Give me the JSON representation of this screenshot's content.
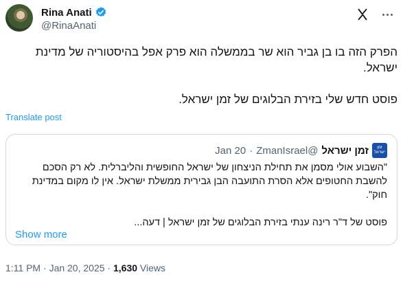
{
  "author": {
    "display_name": "Rina Anati",
    "handle": "@RinaAnati"
  },
  "icons": {
    "avatar": "profile-photo",
    "verified": "verified-badge-icon",
    "grok": "grok-icon",
    "more": "more-dots-icon",
    "accent_color": "#1d9bf0"
  },
  "tweet": {
    "paragraphs": [
      "הפרק הזה בו בן גביר הוא שר בממשלה הוא פרק אפל בהיסטוריה של מדינת ישראל.",
      "פוסט חדש שלי בזירת הבלוגים של זמן ישראל."
    ],
    "translate_label": "Translate post"
  },
  "quote": {
    "avatar_text": "זמן ישראל",
    "name": "זמן ישראל",
    "handle": "@ZmanIsrael",
    "separator": "·",
    "date": "Jan 20",
    "paragraphs": [
      "\"השבוע אולי מסמן את תחילת הניצחון של ישראל החופשית והליברלית. לא רק הסכם להשבת החטופים אלא הסרת התועבה הבן גבירית ממשלת ישראל. אין לו מקום במדינת חוק\".",
      "פוסט של ד\"ר רינה ענתי בזירת הבלוגים של זמן ישראל | דעה..."
    ],
    "show_more": "Show more"
  },
  "meta": {
    "time": "1:11 PM",
    "separator": "·",
    "date": "Jan 20, 2025",
    "views_count": "1,630",
    "views_label": "Views"
  }
}
